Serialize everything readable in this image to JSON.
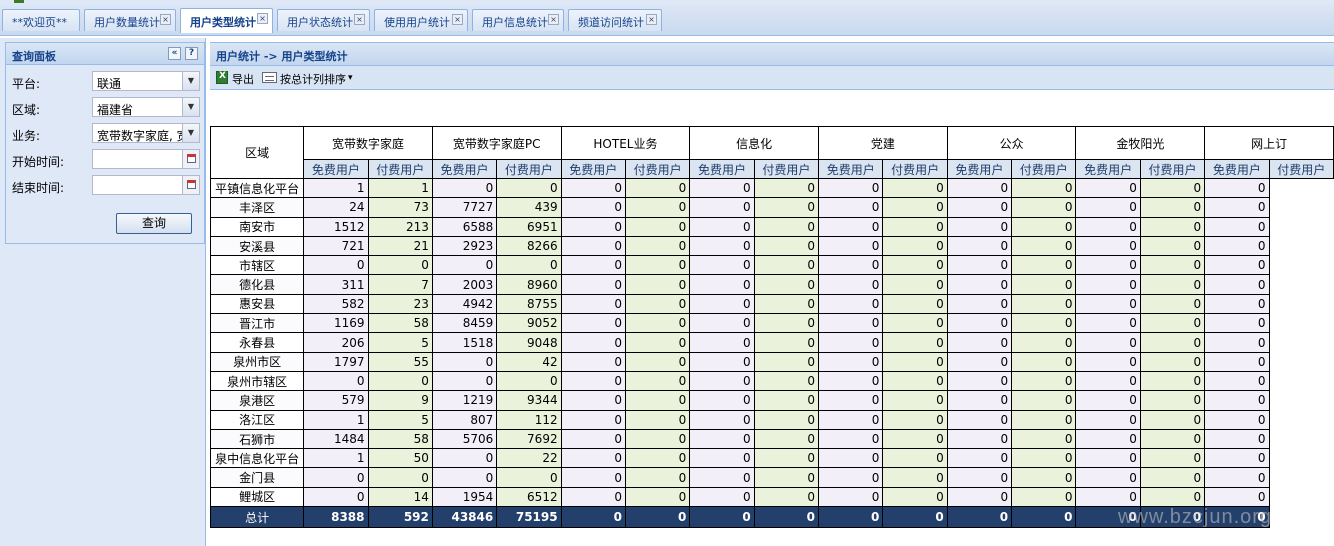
{
  "tabs": [
    {
      "label": "**欢迎页**",
      "active": false
    },
    {
      "label": "用户数量统计",
      "active": false
    },
    {
      "label": "用户类型统计",
      "active": true
    },
    {
      "label": "用户状态统计",
      "active": false
    },
    {
      "label": "使用用户统计",
      "active": false
    },
    {
      "label": "用户信息统计",
      "active": false
    },
    {
      "label": "频道访问统计",
      "active": false
    }
  ],
  "query_panel": {
    "title": "查询面板",
    "collapse_glyph": "«",
    "help_glyph": "?",
    "platform_label": "平台:",
    "platform_value": "联通",
    "region_label": "区域:",
    "region_value": "福建省",
    "business_label": "业务:",
    "business_value": "宽带数字家庭, 宽",
    "start_label": "开始时间:",
    "end_label": "结束时间:",
    "query_button": "查询"
  },
  "main": {
    "breadcrumb": "用户统计 -> 用户类型统计",
    "export_label": "导出",
    "sort_label": "按总计列排序",
    "sort_arrow": "▾"
  },
  "grid": {
    "region_header": "区域",
    "groups": [
      "宽带数字家庭",
      "宽带数字家庭PC",
      "HOTEL业务",
      "信息化",
      "党建",
      "公众",
      "金牧阳光",
      "网上订"
    ],
    "sub_free": "免费用户",
    "sub_paid": "付费用户",
    "rows": [
      {
        "region": "平镇信息化平台",
        "vals": [
          1,
          1,
          0,
          0,
          0,
          0,
          0,
          0,
          0,
          0,
          0,
          0,
          0,
          0,
          0
        ]
      },
      {
        "region": "丰泽区",
        "vals": [
          24,
          73,
          7727,
          439,
          0,
          0,
          0,
          0,
          0,
          0,
          0,
          0,
          0,
          0,
          0
        ]
      },
      {
        "region": "南安市",
        "vals": [
          1512,
          213,
          6588,
          6951,
          0,
          0,
          0,
          0,
          0,
          0,
          0,
          0,
          0,
          0,
          0
        ]
      },
      {
        "region": "安溪县",
        "vals": [
          721,
          21,
          2923,
          8266,
          0,
          0,
          0,
          0,
          0,
          0,
          0,
          0,
          0,
          0,
          0
        ]
      },
      {
        "region": "市辖区",
        "vals": [
          0,
          0,
          0,
          0,
          0,
          0,
          0,
          0,
          0,
          0,
          0,
          0,
          0,
          0,
          0
        ]
      },
      {
        "region": "德化县",
        "vals": [
          311,
          7,
          2003,
          8960,
          0,
          0,
          0,
          0,
          0,
          0,
          0,
          0,
          0,
          0,
          0
        ]
      },
      {
        "region": "惠安县",
        "vals": [
          582,
          23,
          4942,
          8755,
          0,
          0,
          0,
          0,
          0,
          0,
          0,
          0,
          0,
          0,
          0
        ]
      },
      {
        "region": "晋江市",
        "vals": [
          1169,
          58,
          8459,
          9052,
          0,
          0,
          0,
          0,
          0,
          0,
          0,
          0,
          0,
          0,
          0
        ]
      },
      {
        "region": "永春县",
        "vals": [
          206,
          5,
          1518,
          9048,
          0,
          0,
          0,
          0,
          0,
          0,
          0,
          0,
          0,
          0,
          0
        ]
      },
      {
        "region": "泉州市区",
        "vals": [
          1797,
          55,
          0,
          42,
          0,
          0,
          0,
          0,
          0,
          0,
          0,
          0,
          0,
          0,
          0
        ]
      },
      {
        "region": "泉州市辖区",
        "vals": [
          0,
          0,
          0,
          0,
          0,
          0,
          0,
          0,
          0,
          0,
          0,
          0,
          0,
          0,
          0
        ]
      },
      {
        "region": "泉港区",
        "vals": [
          579,
          9,
          1219,
          9344,
          0,
          0,
          0,
          0,
          0,
          0,
          0,
          0,
          0,
          0,
          0
        ]
      },
      {
        "region": "洛江区",
        "vals": [
          1,
          5,
          807,
          112,
          0,
          0,
          0,
          0,
          0,
          0,
          0,
          0,
          0,
          0,
          0
        ]
      },
      {
        "region": "石狮市",
        "vals": [
          1484,
          58,
          5706,
          7692,
          0,
          0,
          0,
          0,
          0,
          0,
          0,
          0,
          0,
          0,
          0
        ]
      },
      {
        "region": "泉中信息化平台",
        "vals": [
          1,
          50,
          0,
          22,
          0,
          0,
          0,
          0,
          0,
          0,
          0,
          0,
          0,
          0,
          0
        ]
      },
      {
        "region": "金门县",
        "vals": [
          0,
          0,
          0,
          0,
          0,
          0,
          0,
          0,
          0,
          0,
          0,
          0,
          0,
          0,
          0
        ]
      },
      {
        "region": "鲤城区",
        "vals": [
          0,
          14,
          1954,
          6512,
          0,
          0,
          0,
          0,
          0,
          0,
          0,
          0,
          0,
          0,
          0
        ]
      }
    ],
    "total_label": "总计",
    "total_vals": [
      8388,
      592,
      43846,
      75195,
      0,
      0,
      0,
      0,
      0,
      0,
      0,
      0,
      0,
      0,
      0
    ]
  },
  "watermark": "www.bzcjun.org"
}
